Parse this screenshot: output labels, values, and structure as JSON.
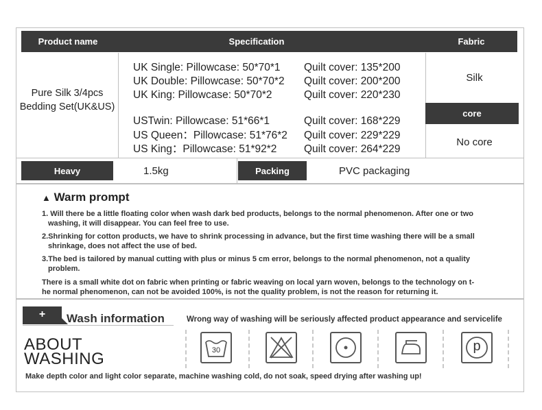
{
  "table": {
    "headers": {
      "product": "Product name",
      "spec": "Specification",
      "fabric": "Fabric"
    },
    "product_name": "Pure Silk 3/4pcs Bedding Set(UK&US)",
    "uk": [
      {
        "size": "UK Single: Pillowcase: 50*70*1",
        "quilt": "Quilt cover: 135*200"
      },
      {
        "size": "UK Double: Pillowcase: 50*70*2",
        "quilt": "Quilt cover: 200*200"
      },
      {
        "size": "UK King: Pillowcase: 50*70*2",
        "quilt": "Quilt cover: 220*230"
      }
    ],
    "us": [
      {
        "size": "USTwin: Pillowcase: 51*66*1",
        "quilt": "Quilt cover: 168*229"
      },
      {
        "size": "US Queen：Pillowcase: 51*76*2",
        "quilt": "Quilt cover: 229*229"
      },
      {
        "size": "US King：Pillowcase: 51*92*2",
        "quilt": "Quilt cover: 264*229"
      }
    ],
    "fabric_value": "Silk",
    "core_label": "core",
    "core_value": "No core",
    "heavy_label": "Heavy",
    "heavy_value": "1.5kg",
    "packing_label": "Packing",
    "packing_value": "PVC packaging"
  },
  "warm_prompt": {
    "title": "Warm prompt",
    "items": [
      {
        "line1": "1. Will there be a little floating color when wash dark bed products, belongs to the normal phenomenon. After one or two",
        "line2": "washing, it will disappear. You can feel free to use."
      },
      {
        "line1": "2.Shrinking for cotton products, we have to shrink processing in advance, but the first time washing there will be a small",
        "line2": "shrinkage, does not affect the use of bed."
      },
      {
        "line1": "3.The bed is tailored by manual cutting with plus or minus 5 cm error, belongs to the normal phenomenon, not a quality",
        "line2": "problem."
      }
    ],
    "note_line1": "There is a small white dot on fabric when printing or fabric weaving on local yarn woven, belongs to the technology on t-",
    "note_line2": "he normal phenomenon, can not be avoided 100%, is not the quality problem, is not the reason for returning it."
  },
  "wash": {
    "plus": "+",
    "title": "Wash information",
    "subtitle": "Wrong way of washing will be seriously affected product appearance and servicelife",
    "about_line1": "ABOUT",
    "about_line2": "WASHING",
    "temp": "30",
    "dryclean_letter": "p",
    "footer": "Make depth color and light color separate, machine washing cold, do not soak, speed drying after washing up!",
    "icons": [
      "wash-30-icon",
      "no-bleach-icon",
      "tumble-dry-icon",
      "iron-icon",
      "dry-clean-p-icon"
    ]
  }
}
